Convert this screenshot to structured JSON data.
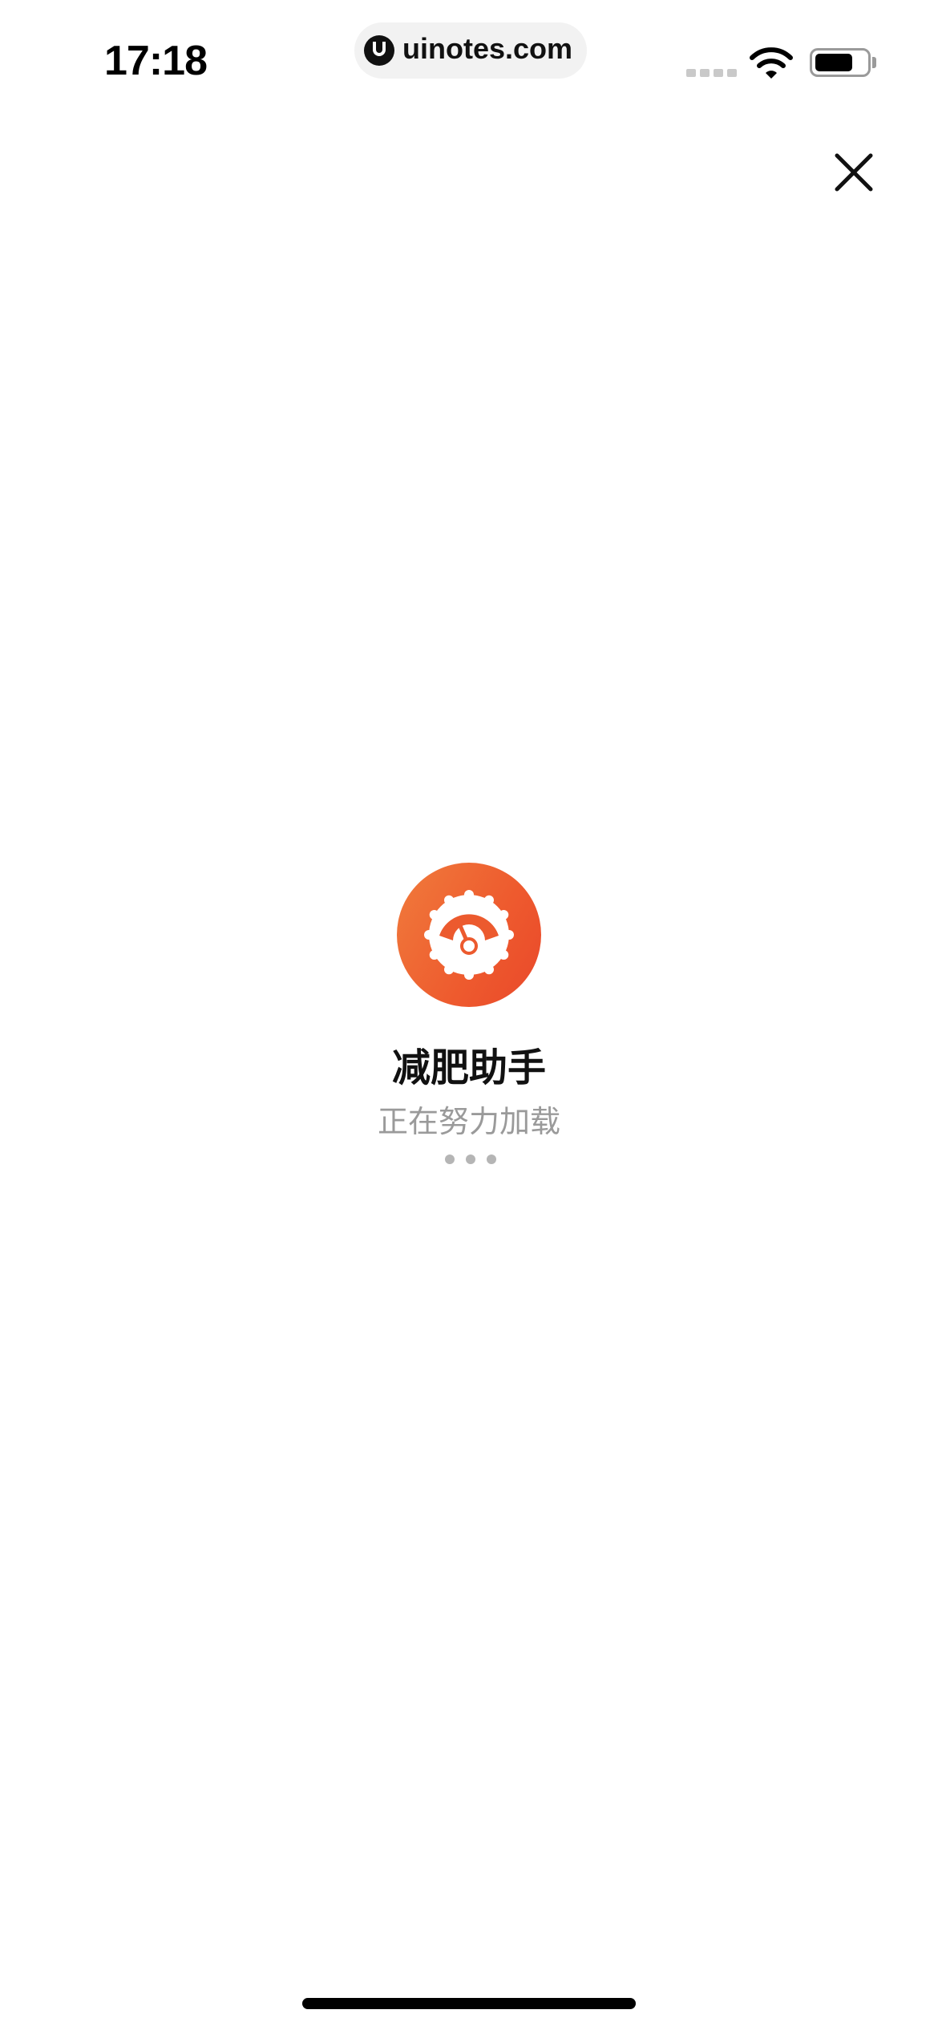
{
  "status_bar": {
    "time": "17:18",
    "url": "uinotes.com",
    "icons": {
      "site": "uinotes-logo-icon",
      "signal": "cellular-signal-icon",
      "wifi": "wifi-icon",
      "battery": "battery-icon"
    }
  },
  "close_button": {
    "icon": "close-icon"
  },
  "loading": {
    "app_icon": "speedometer-icon",
    "app_name": "减肥助手",
    "status": "正在努力加载",
    "indicator": "loading-dots-icon"
  },
  "colors": {
    "logo_gradient_start": "#f07b3c",
    "logo_gradient_end": "#e9482a",
    "loading_text": "#9a9a9a",
    "dots": "#b5b5b5"
  }
}
